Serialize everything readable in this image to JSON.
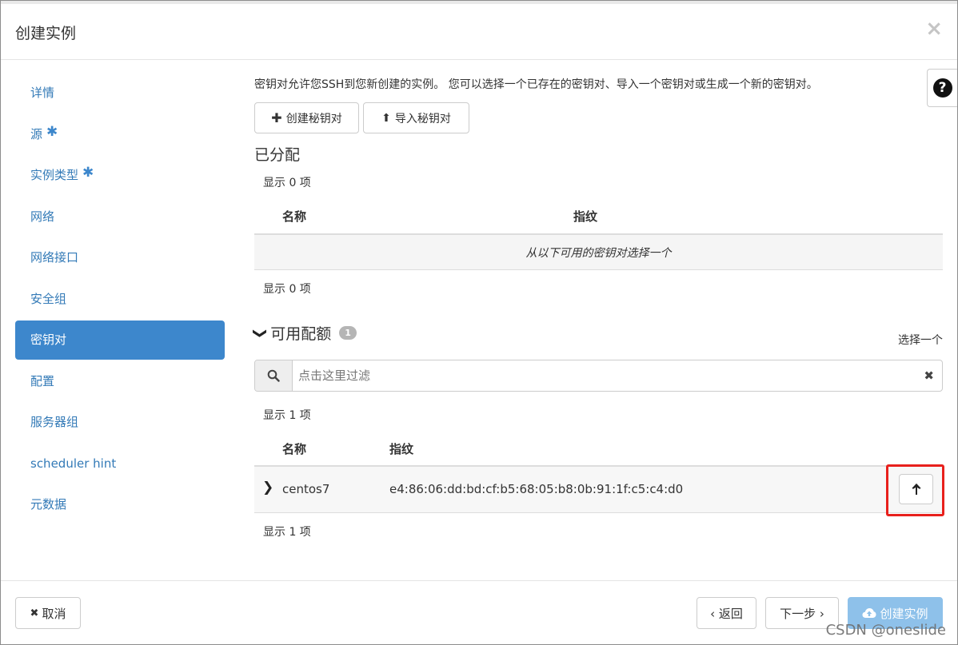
{
  "modal": {
    "title": "创建实例",
    "close_icon": "×"
  },
  "sidebar": {
    "items": [
      {
        "label": "详情",
        "required": false,
        "active": false
      },
      {
        "label": "源",
        "required": true,
        "active": false
      },
      {
        "label": "实例类型",
        "required": true,
        "active": false
      },
      {
        "label": "网络",
        "required": false,
        "active": false
      },
      {
        "label": "网络接口",
        "required": false,
        "active": false
      },
      {
        "label": "安全组",
        "required": false,
        "active": false
      },
      {
        "label": "密钥对",
        "required": false,
        "active": true
      },
      {
        "label": "配置",
        "required": false,
        "active": false
      },
      {
        "label": "服务器组",
        "required": false,
        "active": false
      },
      {
        "label": "scheduler hint",
        "required": false,
        "active": false
      },
      {
        "label": "元数据",
        "required": false,
        "active": false
      }
    ],
    "required_mark": "✱"
  },
  "main": {
    "intro": "密钥对允许您SSH到您新创建的实例。 您可以选择一个已存在的密钥对、导入一个密钥对或生成一个新的密钥对。",
    "help_icon": "?",
    "create_keypair": {
      "icon": "plus-icon",
      "glyph": "✚",
      "label": "创建秘钥对"
    },
    "import_keypair": {
      "icon": "upload-icon",
      "glyph": "⬆",
      "label": "导入秘钥对"
    },
    "allocated": {
      "title": "已分配",
      "count_top": "显示 0 项",
      "headers": {
        "name": "名称",
        "fingerprint": "指纹"
      },
      "empty_message": "从以下可用的密钥对选择一个",
      "count_bottom": "显示 0 项"
    },
    "available": {
      "title": "可用配额",
      "badge": "1",
      "chevron": "❯",
      "select_one": "选择一个",
      "filter_placeholder": "点击这里过滤",
      "filter_value": "",
      "count_top": "显示 1 项",
      "headers": {
        "name": "名称",
        "fingerprint": "指纹"
      },
      "rows": [
        {
          "name": "centos7",
          "fingerprint": "e4:86:06:dd:bd:cf:b5:68:05:b8:0b:91:1f:c5:c4:d0"
        }
      ],
      "count_bottom": "显示 1 项"
    }
  },
  "footer": {
    "cancel": {
      "icon": "close-icon",
      "label": "取消"
    },
    "back": {
      "label": "‹ 返回"
    },
    "next": {
      "label": "下一步 ›"
    },
    "create": {
      "icon": "cloud-upload-icon",
      "label": "创建实例"
    }
  },
  "watermark": "CSDN @oneslide",
  "colors": {
    "accent": "#3d87cc",
    "link": "#337ab7",
    "primary_disabled": "#8ec1ea",
    "highlight": "#e8201c"
  }
}
